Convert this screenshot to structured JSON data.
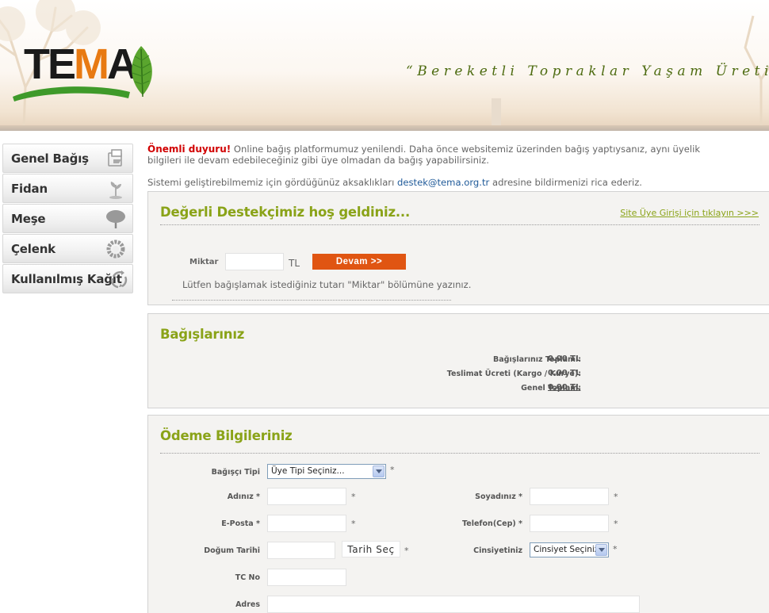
{
  "header": {
    "logo_text_left": "TE",
    "logo_text_accent": "M",
    "logo_text_right": "A",
    "slogan": "“Bereketli Topraklar Yaşam Üretir”"
  },
  "sidebar": {
    "items": [
      {
        "label": "Genel Bağış",
        "icon": "gift-icon"
      },
      {
        "label": "Fidan",
        "icon": "sapling-icon"
      },
      {
        "label": "Meşe",
        "icon": "oak-tree-icon"
      },
      {
        "label": "Çelenk",
        "icon": "wreath-icon"
      },
      {
        "label": "Kullanılmış Kağıt",
        "icon": "recycle-icon"
      }
    ]
  },
  "notice": {
    "important_label": "Önemli duyuru!",
    "text": " Online bağış platformumuz yenilendi. Daha önce websitemiz üzerinden bağış yaptıysanız, aynı üyelik bilgileri ile devam edebileceğiniz gibi üye olmadan da bağış yapabilirsiniz.",
    "feedback_before": "Sistemi geliştirebilmemiz için gördüğünüz aksaklıkları ",
    "email": "destek@tema.org.tr",
    "feedback_after": " adresine bildirmenizi rica ederiz."
  },
  "welcome": {
    "title": "Değerli Destekçimiz hoş geldiniz...",
    "login_link": "Site Üye Girişi için tıklayın >>>",
    "amount_label": "Miktar",
    "amount_value": "",
    "currency": "TL",
    "continue_button": "Devam >>",
    "help_text": "Lütfen bağışlamak istediğiniz tutarı \"Miktar\" bölümüne yazınız."
  },
  "donations": {
    "title": "Bağışlarınız",
    "rows": [
      {
        "label": "Bağışlarınız Toplamı:",
        "value": "0.00 TL"
      },
      {
        "label": "Teslimat Ücreti (Kargo / Kurye):",
        "value": "0.00 TL"
      },
      {
        "label": "Genel Toplam:",
        "value": "0.00 TL"
      }
    ]
  },
  "payment": {
    "title": "Ödeme Bilgileriniz",
    "donor_type_label": "Bağışçı Tipi",
    "donor_type_selected": "Üye Tipi Seçiniz...",
    "first_name_label": "Adınız *",
    "last_name_label": "Soyadınız *",
    "email_label": "E-Posta *",
    "phone_label": "Telefon(Cep) *",
    "birth_date_label": "Doğum Tarihi",
    "date_button": "Tarih Seç",
    "gender_label": "Cinsiyetiniz",
    "gender_selected": "Cinsiyet Seçiniz.",
    "tc_label": "TC No",
    "address_label": "Adres",
    "required_mark": "*"
  }
}
